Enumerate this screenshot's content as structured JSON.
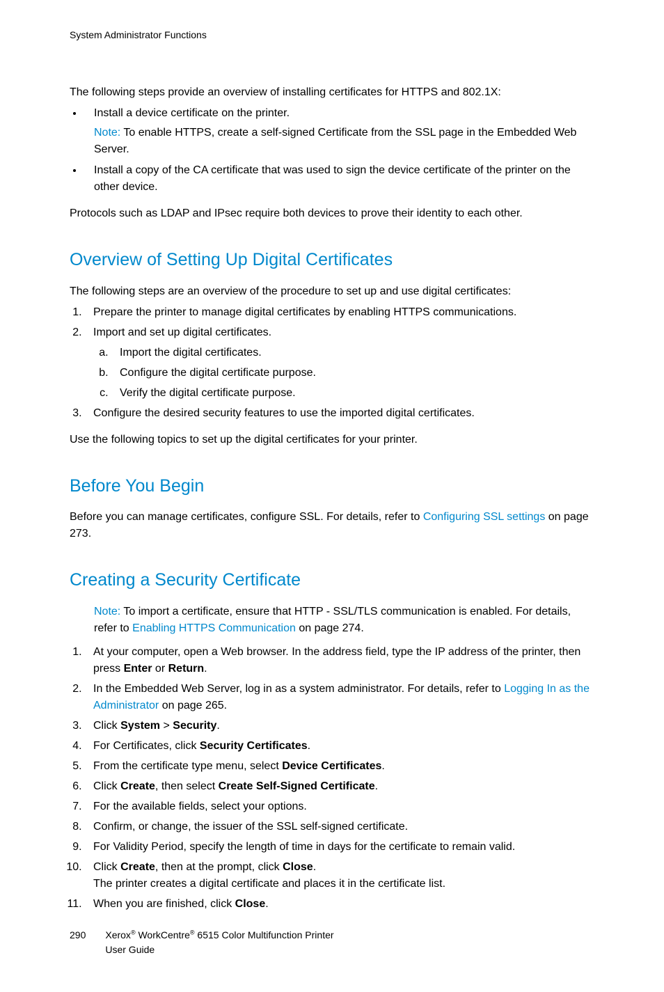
{
  "header": "System Administrator Functions",
  "intro": "The following steps provide an overview of installing certificates for HTTPS and 802.1X:",
  "bullets": {
    "b1": "Install a device certificate on the printer.",
    "note_label": "Note:",
    "b1_note": " To enable HTTPS, create a self-signed Certificate from the SSL page in the Embedded Web Server.",
    "b2": "Install a copy of the CA certificate that was used to sign the device certificate of the printer on the other device."
  },
  "protocols_para": "Protocols such as LDAP and IPsec require both devices to prove their identity to each other.",
  "overview": {
    "heading": "Overview of Setting Up Digital Certificates",
    "intro": "The following steps are an overview of the procedure to set up and use digital certificates:",
    "s1": "Prepare the printer to manage digital certificates by enabling HTTPS communications.",
    "s2": "Import and set up digital certificates.",
    "s2a": "Import the digital certificates.",
    "s2b": "Configure the digital certificate purpose.",
    "s2c": "Verify the digital certificate purpose.",
    "s3": "Configure the desired security features to use the imported digital certificates.",
    "outro": "Use the following topics to set up the digital certificates for your printer."
  },
  "before": {
    "heading": "Before You Begin",
    "p1a": "Before you can manage certificates, configure SSL. For details, refer to ",
    "link": "Configuring SSL settings",
    "p1b": " on page 273."
  },
  "creating": {
    "heading": "Creating a Security Certificate",
    "note_label": "Note:",
    "note_a": " To import a certificate, ensure that HTTP - SSL/TLS communication is enabled. For details, refer to ",
    "note_link": "Enabling HTTPS Communication",
    "note_b": " on page 274.",
    "s1a": "At your computer, open a Web browser. In the address field, type the IP address of the printer, then press ",
    "s1b": "Enter",
    "s1c": " or ",
    "s1d": "Return",
    "s1e": ".",
    "s2a": "In the Embedded Web Server, log in as a system administrator. For details, refer to ",
    "s2link": "Logging In as the Administrator",
    "s2b": " on page 265.",
    "s3a": "Click ",
    "s3b": "System",
    "s3c": " > ",
    "s3d": "Security",
    "s3e": ".",
    "s4a": "For Certificates, click ",
    "s4b": "Security Certificates",
    "s4c": ".",
    "s5a": "From the certificate type menu, select ",
    "s5b": "Device Certificates",
    "s5c": ".",
    "s6a": "Click ",
    "s6b": "Create",
    "s6c": ", then select ",
    "s6d": "Create Self-Signed Certificate",
    "s6e": ".",
    "s7": "For the available fields, select your options.",
    "s8": "Confirm, or change, the issuer of the SSL self-signed certificate.",
    "s9": "For Validity Period, specify the length of time in days for the certificate to remain valid.",
    "s10a": "Click ",
    "s10b": "Create",
    "s10c": ", then at the prompt, click ",
    "s10d": "Close",
    "s10e": ".",
    "s10f": "The printer creates a digital certificate and places it in the certificate list.",
    "s11a": "When you are finished, click ",
    "s11b": "Close",
    "s11c": "."
  },
  "footer": {
    "pagenum": "290",
    "line1a": "Xerox",
    "line1b": " WorkCentre",
    "line1c": " 6515 Color Multifunction Printer",
    "line2": "User Guide"
  }
}
